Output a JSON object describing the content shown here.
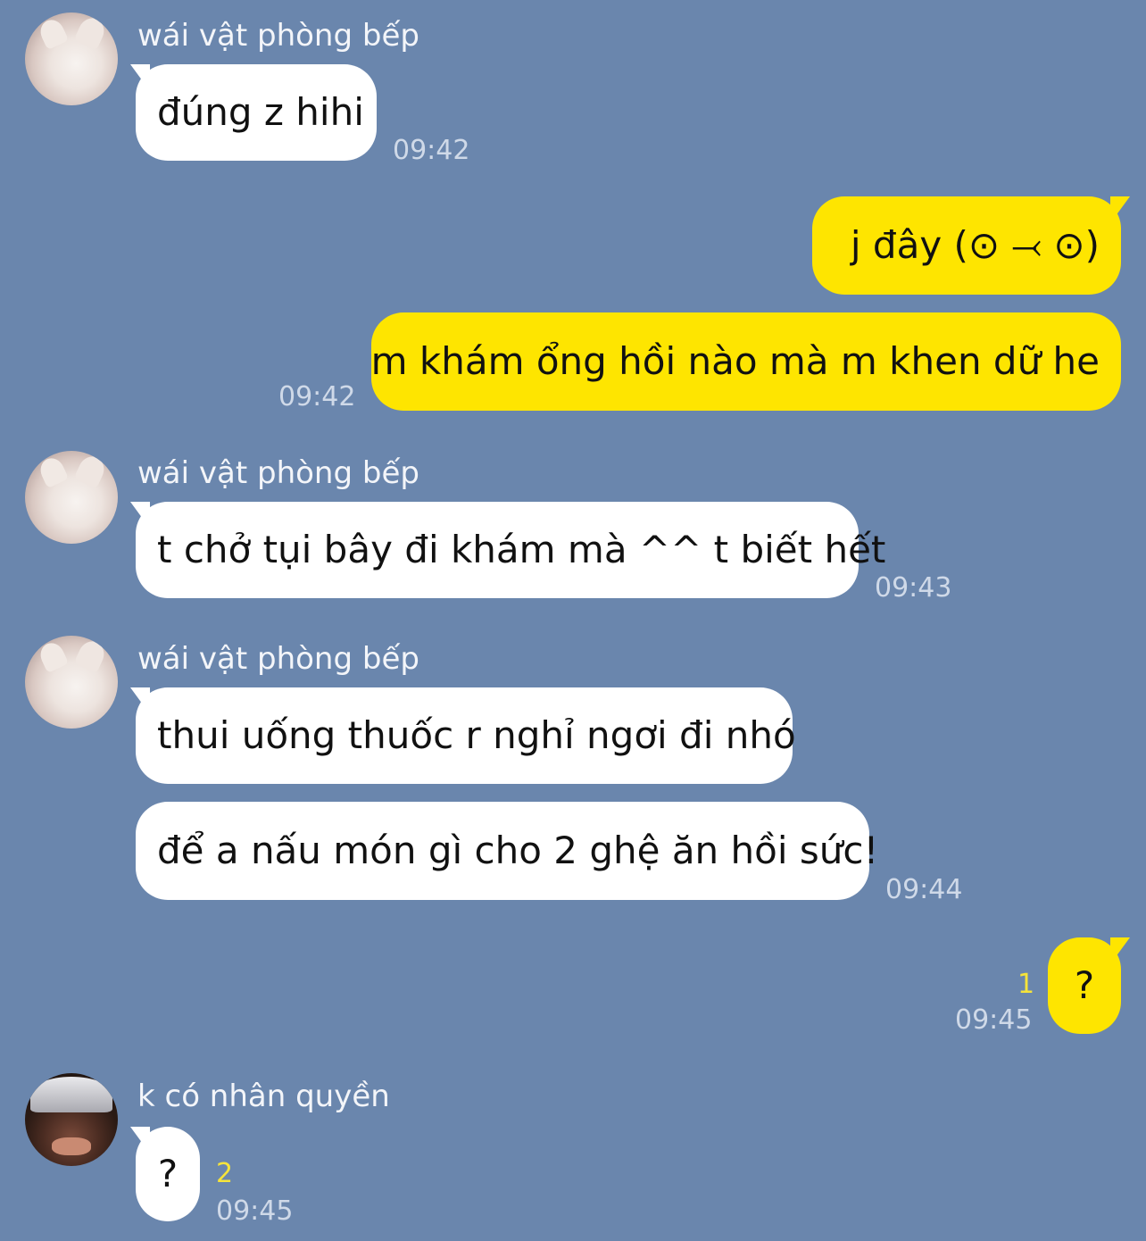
{
  "colors": {
    "background": "#6a86ad",
    "incoming_bubble": "#ffffff",
    "outgoing_bubble": "#fee500",
    "timestamp": "#cfd9e8",
    "unread_count": "#f6e43a"
  },
  "messages": {
    "m1": {
      "sender": "wái vật phòng bếp",
      "text": "đúng z hihi",
      "time": "09:42"
    },
    "m2": {
      "text": "j đây (⊙ ⤙ ⊙)"
    },
    "m3": {
      "text": "m khám ổng hồi nào mà m khen dữ he",
      "time": "09:42"
    },
    "m4": {
      "sender": "wái vật phòng bếp",
      "text": "t chở tụi bây đi khám mà ^^ t biết hết",
      "time": "09:43"
    },
    "m5": {
      "sender": "wái vật phòng bếp",
      "text": "thui uống thuốc r nghỉ ngơi đi nhó"
    },
    "m6": {
      "text": "để a nấu món gì cho 2 ghệ ăn hồi sức!",
      "time": "09:44"
    },
    "m7": {
      "text": "?",
      "unread": "1",
      "time": "09:45"
    },
    "m8": {
      "sender": "k có nhân quyền",
      "text": "?",
      "unread": "2",
      "time": "09:45"
    }
  }
}
